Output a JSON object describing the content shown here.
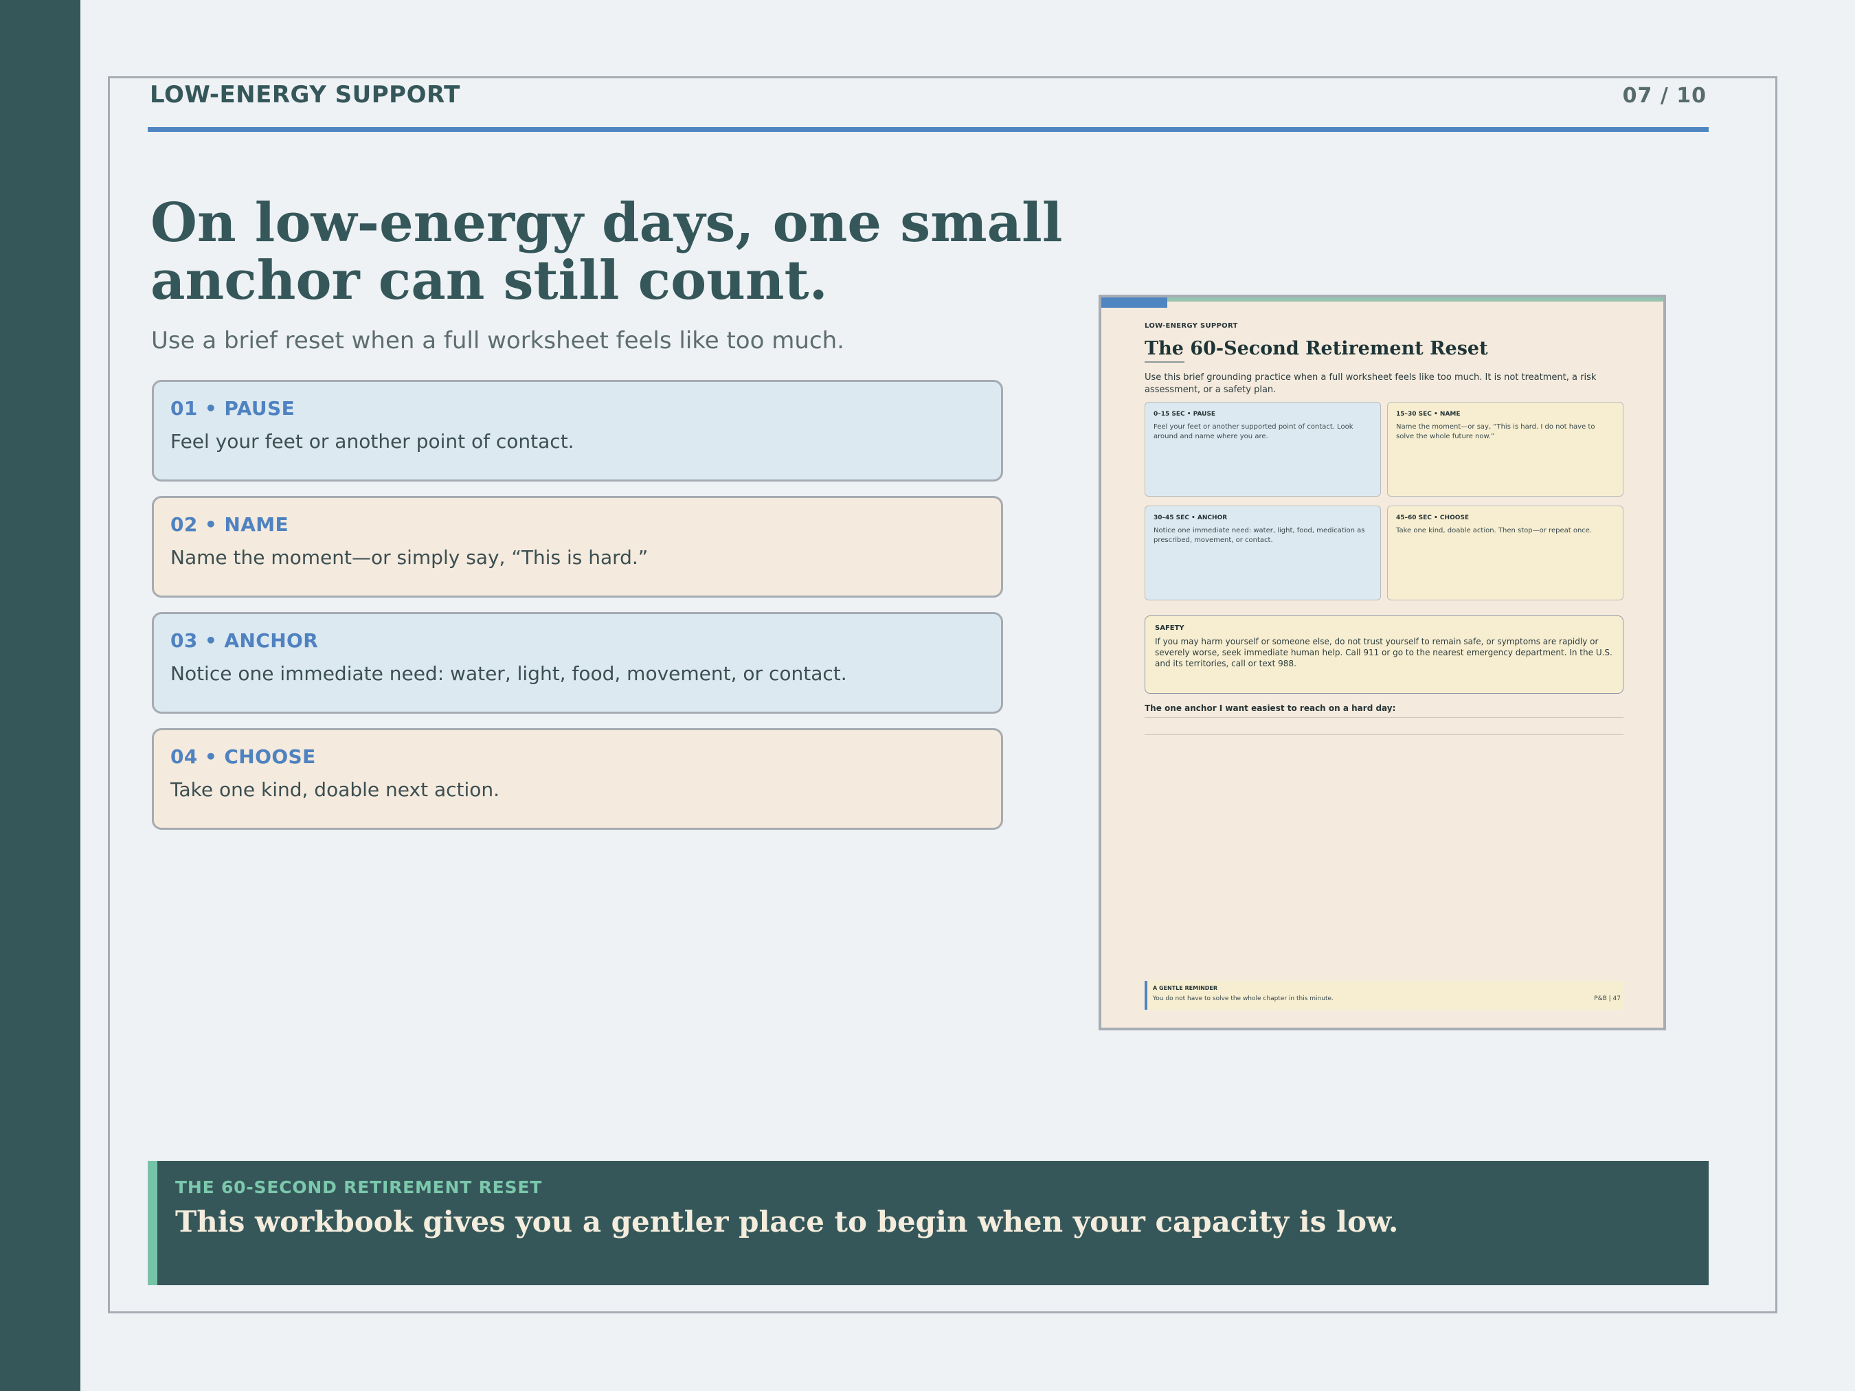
{
  "header": {
    "label": "LOW-ENERGY SUPPORT",
    "page_counter": "07 / 10"
  },
  "main": {
    "headline": "On low-energy days, one small anchor can still count.",
    "subline": "Use a brief reset when a full worksheet feels like too much."
  },
  "steps": [
    {
      "title": "01 • PAUSE",
      "text": "Feel your feet or another point of contact."
    },
    {
      "title": "02 • NAME",
      "text": "Name the moment—or simply say, “This is hard.”"
    },
    {
      "title": "03 • ANCHOR",
      "text": "Notice one immediate need: water, light, food, movement, or contact."
    },
    {
      "title": "04 • CHOOSE",
      "text": "Take one kind, doable next action."
    }
  ],
  "preview": {
    "label": "LOW-ENERGY SUPPORT",
    "title": "The 60-Second Retirement Reset",
    "intro": "Use this brief grounding practice when a full worksheet feels like too much. It is not treatment, a risk assessment, or a safety plan.",
    "cards": [
      {
        "title": "0–15 SEC • PAUSE",
        "text": "Feel your feet or another supported point of contact. Look around and name where you are."
      },
      {
        "title": "15–30 SEC • NAME",
        "text": "Name the moment—or say, “This is hard. I do not have to solve the whole future now.”"
      },
      {
        "title": "30–45 SEC • ANCHOR",
        "text": "Notice one immediate need: water, light, food, medication as prescribed, movement, or contact."
      },
      {
        "title": "45–60 SEC • CHOOSE",
        "text": "Take one kind, doable action. Then stop—or repeat once."
      }
    ],
    "safety_title": "SAFETY",
    "safety_text": "If you may harm yourself or someone else, do not trust yourself to remain safe, or symptoms are rapidly or severely worse, seek immediate human help. Call 911 or go to the nearest emergency department. In the U.S. and its territories, call or text 988.",
    "anchor_prompt": "The one anchor I want easiest to reach on a hard day:",
    "reminder_title": "A GENTLE REMINDER",
    "reminder_text": "You do not have to solve the whole chapter in this minute.",
    "page_ref": "P&B  |  47"
  },
  "banner": {
    "kicker": "THE 60-SECOND RETIREMENT RESET",
    "text": "This workbook gives you a gentler place to begin when your capacity is low."
  },
  "colors": {
    "sidebar": "#35575a",
    "accent_blue": "#4f86c1",
    "accent_green": "#77c3a8",
    "card_blue": "#dde9f1",
    "card_tan": "#f4eadd"
  }
}
